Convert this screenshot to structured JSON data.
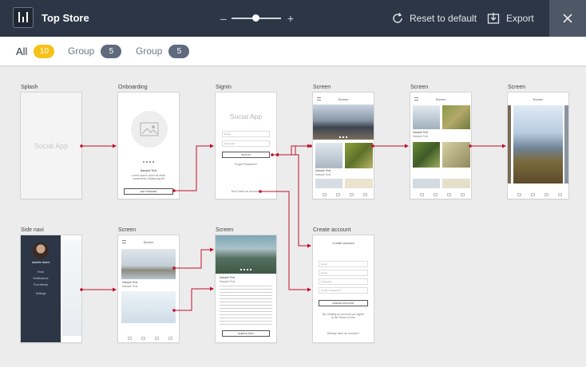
{
  "header": {
    "app_title": "Top Store",
    "zoom_minus": "–",
    "zoom_plus": "+",
    "reset_label": "Reset to default",
    "export_label": "Export"
  },
  "filters": [
    {
      "label": "All",
      "count": "10"
    },
    {
      "label": "Group",
      "count": "5"
    },
    {
      "label": "Group",
      "count": "5"
    }
  ],
  "screens": {
    "splash": {
      "caption": "Splash",
      "app_name": "Social App"
    },
    "onboarding": {
      "caption": "Onboarding",
      "sample_text": "Sample Text",
      "desc": "Lorem ipsum dolor sit amet consectetur adipiscing elit",
      "button": "GET STARTED"
    },
    "signin": {
      "caption": "SignIn",
      "app_name": "Social App",
      "email": "Email",
      "password": "Password",
      "button": "SIGN IN",
      "forgot": "Forgot Password?",
      "no_account": "Don't have an account?"
    },
    "screen1": {
      "caption": "Screen",
      "header": "Screen",
      "sample": "Sample Text",
      "sub": "Sample Text"
    },
    "screen2": {
      "caption": "Screen",
      "header": "Screen",
      "sample": "Sample Text",
      "sub": "Sample Text"
    },
    "screen3": {
      "caption": "Screen",
      "header": "Screen"
    },
    "sidenavi": {
      "caption": "Side navi",
      "user": "Isabelle Island",
      "items": [
        "Feed",
        "Notifications",
        "Find friends",
        "Settings"
      ]
    },
    "screen4": {
      "caption": "Screen",
      "header": "Screen",
      "sample": "Sample Text",
      "sub": "Sample Text"
    },
    "screen5": {
      "caption": "Screen",
      "sample": "Sample Text",
      "sub": "Sample Text",
      "button": "SAMPLE TEXT"
    },
    "create": {
      "caption": "Create account",
      "header": "Create account",
      "name": "Name",
      "email": "Email",
      "password": "Password",
      "confirm": "Confirm Password",
      "button": "CREATE ACCOUNT",
      "terms": "By creating an account you agree to the Terms of Use",
      "already": "Already have an account?"
    }
  },
  "colors": {
    "accent": "#c0102b",
    "topbar": "#2c3646",
    "badge_gold": "#f6c118",
    "badge_gray": "#5e6a7e"
  }
}
